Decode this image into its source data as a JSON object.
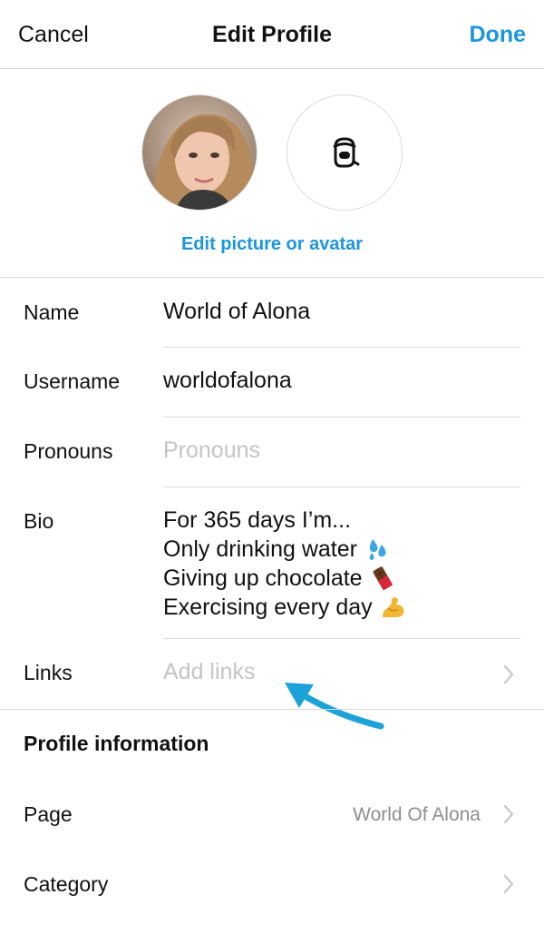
{
  "header": {
    "cancel_label": "Cancel",
    "title": "Edit Profile",
    "done_label": "Done"
  },
  "avatar": {
    "edit_label": "Edit picture or avatar"
  },
  "fields": {
    "name": {
      "label": "Name",
      "value": "World of Alona"
    },
    "username": {
      "label": "Username",
      "value": "worldofalona"
    },
    "pronouns": {
      "label": "Pronouns",
      "placeholder": "Pronouns"
    },
    "bio": {
      "label": "Bio",
      "lines": [
        {
          "text": "For 365 days I’m...",
          "icon": ""
        },
        {
          "text": "Only drinking water",
          "icon": "droplets-emoji"
        },
        {
          "text": "Giving up chocolate",
          "icon": "chocolate-emoji"
        },
        {
          "text": "Exercising every day",
          "icon": "flexed-bicep-emoji"
        }
      ]
    },
    "links": {
      "label": "Links",
      "placeholder": "Add links"
    }
  },
  "profile_information": {
    "title": "Profile information",
    "page": {
      "label": "Page",
      "value": "World Of Alona"
    },
    "category": {
      "label": "Category"
    }
  },
  "colors": {
    "accent": "#1b95e0",
    "divider": "#dbdbdb",
    "placeholder": "#c4c4c4",
    "secondary_text": "#8e8e8e"
  }
}
